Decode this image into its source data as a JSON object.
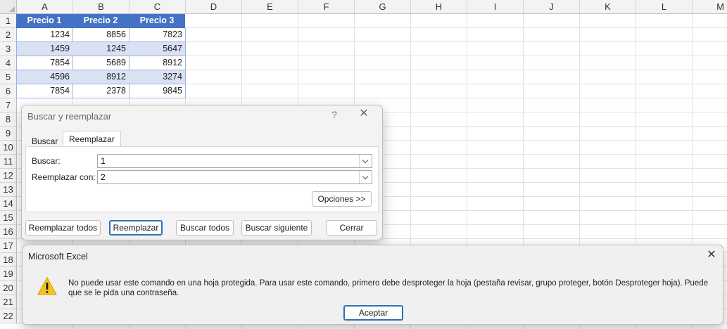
{
  "sheet": {
    "columns": [
      "A",
      "B",
      "C",
      "D",
      "E",
      "F",
      "G",
      "H",
      "I",
      "J",
      "K",
      "L",
      "M"
    ],
    "rows": [
      "1",
      "2",
      "3",
      "4",
      "5",
      "6",
      "7",
      "8",
      "9",
      "10",
      "11",
      "12",
      "13",
      "14",
      "15",
      "16",
      "17",
      "18",
      "19",
      "20",
      "21",
      "22"
    ],
    "table": {
      "headers": [
        "Precio 1",
        "Precio 2",
        "Precio 3"
      ],
      "rows": [
        [
          "1234",
          "8856",
          "7823"
        ],
        [
          "1459",
          "1245",
          "5647"
        ],
        [
          "7854",
          "5689",
          "8912"
        ],
        [
          "4596",
          "8912",
          "3274"
        ],
        [
          "7854",
          "2378",
          "9845"
        ]
      ]
    },
    "colors": {
      "header": "#4472c4",
      "band": "#d9e1f2"
    }
  },
  "find_replace": {
    "title": "Buscar y reemplazar",
    "help": "?",
    "tabs": {
      "find": "Buscar",
      "replace": "Reemplazar"
    },
    "find_label": "Buscar:",
    "find_value": "1",
    "replace_label": "Reemplazar con:",
    "replace_value": "2",
    "options_btn": "Opciones >>",
    "buttons": {
      "replace_all": "Reemplazar todos",
      "replace": "Reemplazar",
      "find_all": "Buscar todos",
      "find_next": "Buscar siguiente",
      "close": "Cerrar"
    }
  },
  "message_box": {
    "title": "Microsoft Excel",
    "icon": "warning-icon",
    "text": "No puede usar este comando en una hoja protegida. Para usar este comando, primero debe desproteger la hoja (pestaña revisar, grupo proteger, botón Desproteger hoja). Puede que se le pida una contraseña.",
    "ok": "Aceptar"
  }
}
